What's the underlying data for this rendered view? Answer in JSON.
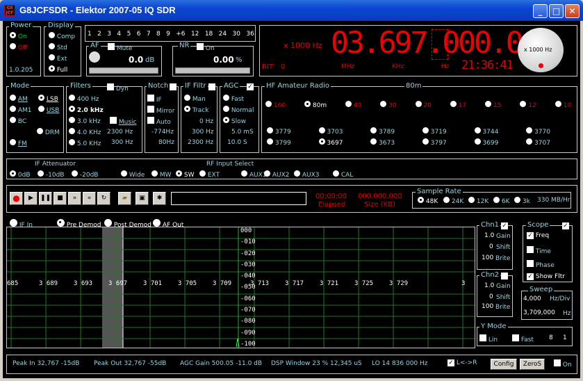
{
  "window": {
    "title": "G8JCFSDR - Elektor 2007-05 IQ SDR",
    "icon_text": "G8 JCF"
  },
  "power": {
    "label": "Power",
    "options": [
      "On",
      "Off"
    ],
    "selected": "On",
    "version": "1.0.205"
  },
  "display": {
    "label": "Display",
    "options": [
      "Comp",
      "Std",
      "Ext",
      "Full"
    ],
    "selected": "Full"
  },
  "meter_scale": [
    "1",
    "2",
    "3",
    "4",
    "5",
    "6",
    "7",
    "8",
    "9",
    "+6",
    "12",
    "18",
    "24",
    "30",
    "36"
  ],
  "af": {
    "label": "AF",
    "mute_label": "Mute",
    "value": "0.0",
    "unit": "dB"
  },
  "nr": {
    "label": "NR",
    "on_label": "On",
    "value": "0.00",
    "unit": "%"
  },
  "freq_display": {
    "multiplier": "x 1000 Hz",
    "frequency": "03.697.000.0",
    "mhz": "MHz",
    "khz": "KHz",
    "hz": "Hz",
    "rit_label": "RIT",
    "rit_value": "0",
    "clock": "21:36:41",
    "knob_label": "x 1000 Hz"
  },
  "mode": {
    "label": "Mode",
    "options": [
      "AM",
      "LSB",
      "AM1",
      "USB",
      "BC",
      "DRM",
      "FM"
    ],
    "selected": "LSB"
  },
  "filters": {
    "label": "Filters",
    "dyn_label": "Dyn",
    "options": [
      "400 Hz",
      "2.0 kHz",
      "3.0 kHz",
      "4.0 KHz",
      "5.0 KHz"
    ],
    "selected": "2.0 kHz",
    "music_label": "Music",
    "val1": "2300 Hz",
    "val2": "300 Hz"
  },
  "notch": {
    "label": "Notch",
    "options": [
      "IF",
      "Mirror",
      "Auto"
    ],
    "val1": "-774Hz",
    "val2": "80Hz"
  },
  "if_filter": {
    "label": "IF Filtr",
    "options": [
      "Man",
      "Track"
    ],
    "selected": "Track",
    "val0": "0 Hz",
    "val1": "300 Hz",
    "val2": "2300 Hz"
  },
  "agc": {
    "label": "AGC",
    "options": [
      "Fast",
      "Normal",
      "Slow"
    ],
    "selected": "Slow",
    "val1": "5.0 mS",
    "val2": "10.0 S"
  },
  "hf_ham": {
    "label": "HF Amateur Radio",
    "band_label": "80m",
    "bands": [
      "160",
      "80m",
      "40",
      "30",
      "20",
      "17",
      "15",
      "12",
      "10"
    ],
    "selected": "80m",
    "mem_row1": [
      "3779",
      "3703",
      "3789",
      "3719",
      "3744",
      "3770"
    ],
    "mem_row2": [
      "3799",
      "3697",
      "3673",
      "3797",
      "3699",
      "3707"
    ],
    "mem_selected": "3697"
  },
  "if_atten": {
    "label": "IF Attenuator",
    "options": [
      "0dB",
      "-10dB",
      "-20dB"
    ],
    "selected": "0dB"
  },
  "rf_input": {
    "label": "RF Input Select",
    "options": [
      "Wide",
      "MW",
      "SW",
      "EXT",
      "AUX1",
      "AUX2",
      "AUX3",
      "CAL"
    ],
    "selected": "SW"
  },
  "recorder": {
    "elapsed_value": "00:00:00",
    "elapsed_label": "Elapsed",
    "size_value": "000,000,000",
    "size_label": "Size (KB)"
  },
  "sample_rate": {
    "label": "Sample Rate",
    "options": [
      "48K",
      "24K",
      "12K",
      "6K",
      "3k"
    ],
    "selected": "48K",
    "rate": "330 MB/Hr"
  },
  "demod_tabs": {
    "options": [
      "IF In",
      "Pre Demod",
      "Post Demod",
      "AF Out"
    ],
    "selected": "Pre Demod"
  },
  "spectrum": {
    "freq_ticks": [
      "685",
      "3 689",
      "3 693",
      "3 697",
      "3 701",
      "3 705",
      "3 709",
      "3 713",
      "3 717",
      "3 721",
      "3 725",
      "3 729",
      "3"
    ],
    "db_ticks": [
      "000",
      "-010",
      "-020",
      "-030",
      "-040",
      "-050",
      "-060",
      "-070",
      "-080",
      "-090",
      "-100"
    ]
  },
  "chn1": {
    "label": "Chn1",
    "gain": "1.0",
    "gain_label": "Gain",
    "shift": "0",
    "shift_label": "Shift",
    "brite": "100",
    "brite_label": "Brite"
  },
  "chn2": {
    "label": "Chn2",
    "gain": "1.0",
    "gain_label": "Gain",
    "shift": "0",
    "shift_label": "Shift",
    "brite": "100",
    "brite_label": "Brite"
  },
  "scope": {
    "label": "Scope",
    "options": [
      "Freq",
      "Time",
      "Phase",
      "Show Fltr"
    ]
  },
  "sweep": {
    "label": "Sweep",
    "div_value": "4,000",
    "div_unit": "Hz/Div",
    "center_value": "3,709,000",
    "center_unit": "Hz"
  },
  "ymode": {
    "label": "Y Mode",
    "lin_label": "Lin",
    "fast_label": "Fast",
    "v1": "8",
    "v2": "1"
  },
  "status": {
    "peak_in": "Peak In 32,767  -15dB",
    "peak_out": "Peak Out 32,767  -55dB",
    "agc_gain": "AGC Gain 500.05  -11.0 dB",
    "dsp_window": "DSP Window  23 % 12,345 uS",
    "lo": "LO      14 836 000 Hz",
    "lr_label": "L<->R",
    "config_label": "Config",
    "zeros_label": "ZeroS",
    "on_label": "On"
  }
}
